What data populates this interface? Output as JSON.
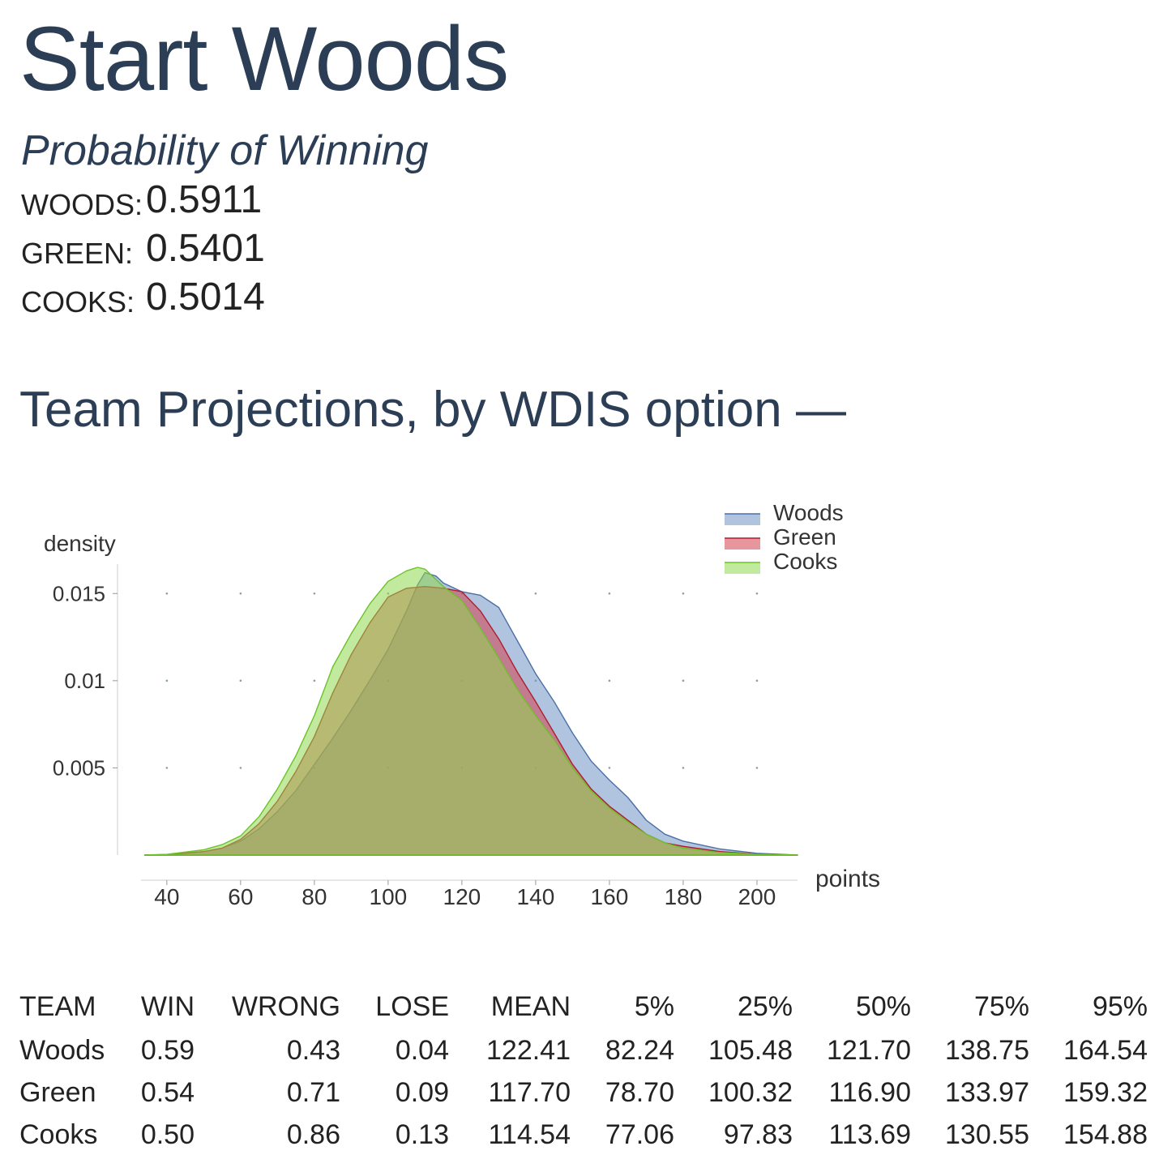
{
  "header": {
    "title": "Start Woods",
    "subtitle": "Probability of Winning"
  },
  "probabilities": [
    {
      "label": "Woods:",
      "value": "0.5911"
    },
    {
      "label": "Green:",
      "value": "0.5401"
    },
    {
      "label": "Cooks:",
      "value": "0.5014"
    }
  ],
  "section_title": "Team Projections, by WDIS option —",
  "colors": {
    "woods": "#6f93c4",
    "green": "#d4404d",
    "cooks": "#8fd84e",
    "woods_stroke": "#4a6fa5",
    "green_stroke": "#b01c2e",
    "cooks_stroke": "#6cc229"
  },
  "chart_data": {
    "type": "area",
    "xlabel": "points",
    "ylabel": "density",
    "xlim": [
      33,
      211
    ],
    "ylim": [
      0,
      0.0165
    ],
    "x_ticks": [
      "40",
      "60",
      "80",
      "100",
      "120",
      "140",
      "160",
      "180",
      "200"
    ],
    "x_tick_values": [
      40,
      60,
      80,
      100,
      120,
      140,
      160,
      180,
      200
    ],
    "y_ticks": [
      "0.005",
      "0.01",
      "0.015"
    ],
    "y_tick_values": [
      0.005,
      0.01,
      0.015
    ],
    "legend_position": "top-right",
    "grid": "dots",
    "series": [
      {
        "name": "Woods",
        "x": [
          34,
          40,
          50,
          55,
          60,
          65,
          70,
          75,
          80,
          85,
          90,
          95,
          100,
          105,
          108,
          110,
          113,
          115,
          120,
          125,
          130,
          135,
          140,
          145,
          150,
          155,
          160,
          165,
          170,
          175,
          180,
          190,
          200,
          211
        ],
        "y": [
          0,
          3e-05,
          0.0002,
          0.0004,
          0.0008,
          0.0015,
          0.0025,
          0.0037,
          0.0052,
          0.0067,
          0.0083,
          0.01,
          0.0118,
          0.014,
          0.0155,
          0.0162,
          0.016,
          0.0156,
          0.0151,
          0.0149,
          0.0142,
          0.0123,
          0.0104,
          0.0088,
          0.007,
          0.0054,
          0.0043,
          0.0033,
          0.002,
          0.0012,
          0.0008,
          0.00035,
          0.0001,
          0
        ]
      },
      {
        "name": "Green",
        "x": [
          34,
          40,
          50,
          55,
          60,
          65,
          70,
          75,
          80,
          85,
          90,
          95,
          100,
          105,
          110,
          115,
          120,
          125,
          130,
          135,
          140,
          145,
          150,
          155,
          160,
          165,
          170,
          175,
          180,
          190,
          200,
          211
        ],
        "y": [
          0,
          3e-05,
          0.0002,
          0.0004,
          0.0009,
          0.0018,
          0.0031,
          0.0048,
          0.0068,
          0.0093,
          0.0115,
          0.0133,
          0.0148,
          0.0153,
          0.0154,
          0.0153,
          0.0151,
          0.014,
          0.0124,
          0.0105,
          0.0088,
          0.007,
          0.0052,
          0.0038,
          0.0028,
          0.002,
          0.0012,
          0.0007,
          0.0005,
          0.0002,
          5e-05,
          0
        ]
      },
      {
        "name": "Cooks",
        "x": [
          34,
          40,
          50,
          55,
          60,
          65,
          70,
          75,
          80,
          85,
          90,
          95,
          100,
          105,
          108,
          110,
          112,
          115,
          120,
          125,
          130,
          135,
          140,
          145,
          150,
          155,
          160,
          165,
          170,
          175,
          180,
          190,
          200,
          211
        ],
        "y": [
          0,
          4e-05,
          0.0003,
          0.0006,
          0.0011,
          0.0022,
          0.0038,
          0.0057,
          0.008,
          0.0108,
          0.0127,
          0.0144,
          0.0157,
          0.0163,
          0.0165,
          0.0164,
          0.016,
          0.0154,
          0.0146,
          0.013,
          0.0113,
          0.0095,
          0.008,
          0.0066,
          0.005,
          0.0037,
          0.0027,
          0.0019,
          0.0012,
          0.0007,
          0.0004,
          0.00015,
          4e-05,
          0
        ]
      }
    ]
  },
  "table": {
    "headers": [
      "TEAM",
      "WIN",
      "WRONG",
      "LOSE",
      "MEAN",
      "5%",
      "25%",
      "50%",
      "75%",
      "95%"
    ],
    "rows": [
      [
        "Woods",
        "0.59",
        "0.43",
        "0.04",
        "122.41",
        "82.24",
        "105.48",
        "121.70",
        "138.75",
        "164.54"
      ],
      [
        "Green",
        "0.54",
        "0.71",
        "0.09",
        "117.70",
        "78.70",
        "100.32",
        "116.90",
        "133.97",
        "159.32"
      ],
      [
        "Cooks",
        "0.50",
        "0.86",
        "0.13",
        "114.54",
        "77.06",
        "97.83",
        "113.69",
        "130.55",
        "154.88"
      ]
    ]
  }
}
